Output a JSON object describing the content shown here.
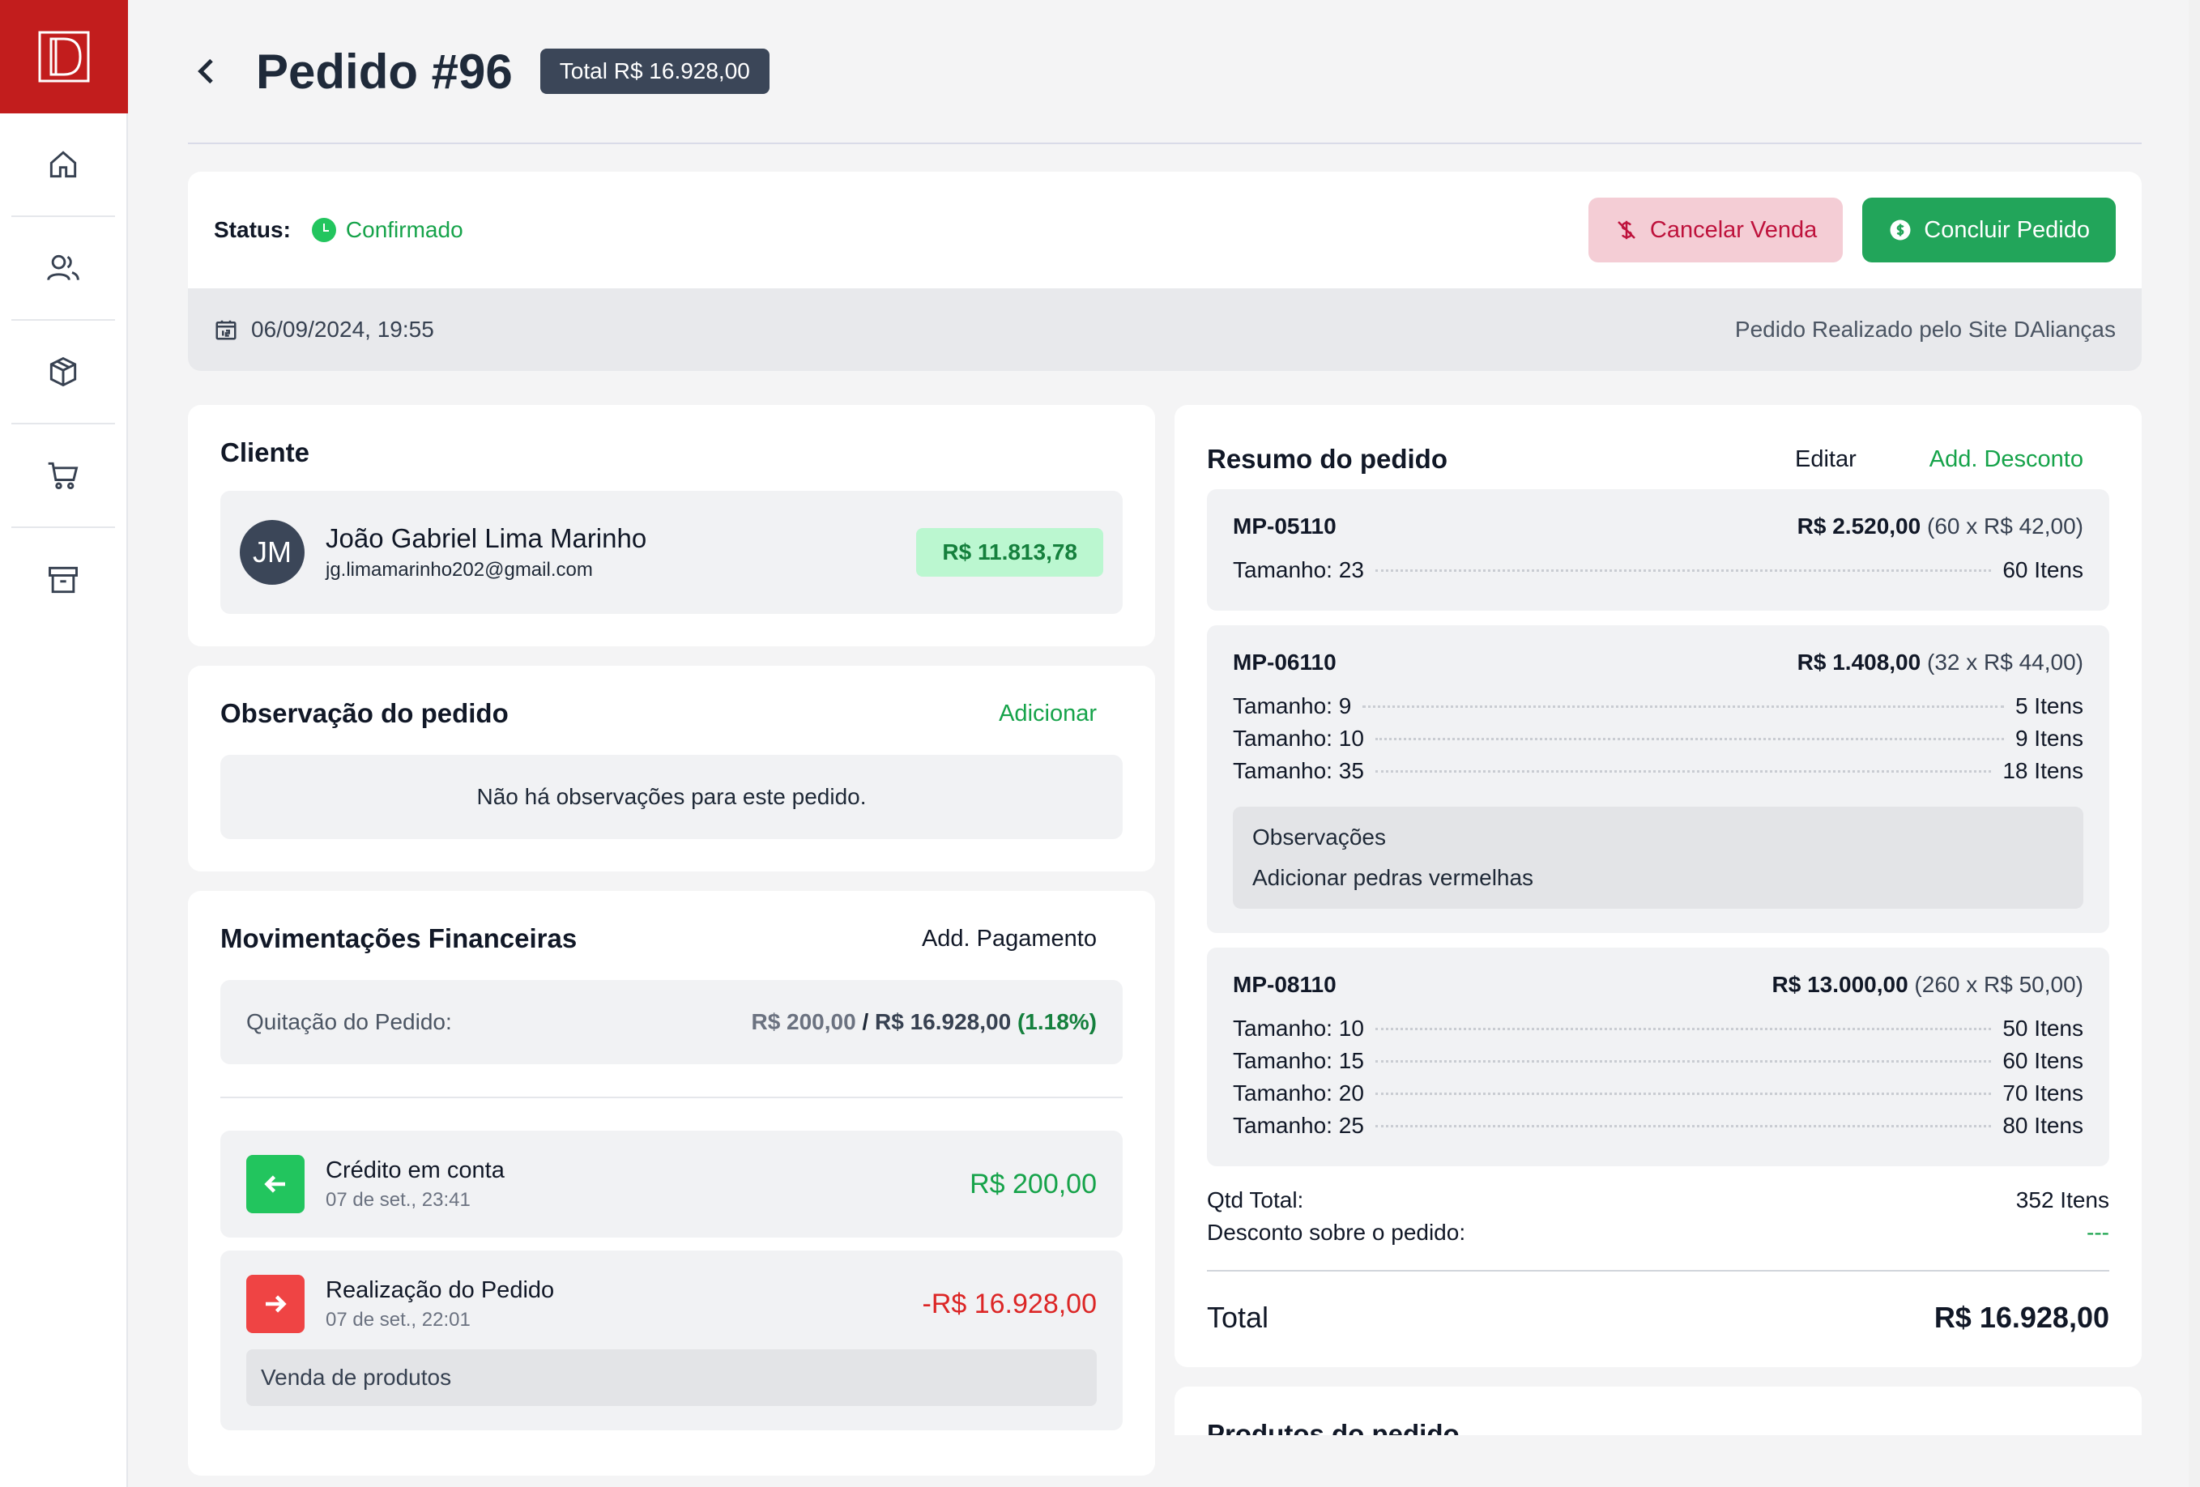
{
  "sidebar": {
    "logo_icon": "brand-logo-icon",
    "items": [
      {
        "icon": "home-icon"
      },
      {
        "icon": "users-icon"
      },
      {
        "icon": "box-icon"
      },
      {
        "icon": "cart-icon"
      },
      {
        "icon": "archive-icon"
      }
    ]
  },
  "header": {
    "title": "Pedido #96",
    "total_badge": "Total R$ 16.928,00"
  },
  "status": {
    "label": "Status:",
    "value": "Confirmado",
    "cancel_label": "Cancelar Venda",
    "conclude_label": "Concluir Pedido"
  },
  "info": {
    "date": "06/09/2024, 19:55",
    "origin": "Pedido Realizado pelo Site DAlianças"
  },
  "client": {
    "title": "Cliente",
    "initials": "JM",
    "name": "João Gabriel Lima Marinho",
    "email": "jg.limamarinho202@gmail.com",
    "amount": "R$ 11.813,78"
  },
  "observation": {
    "title": "Observação do pedido",
    "add_label": "Adicionar",
    "empty_text": "Não há observações para este pedido."
  },
  "finance": {
    "title": "Movimentações Financeiras",
    "add_label": "Add. Pagamento",
    "quitacao_label": "Quitação do Pedido:",
    "paid": "R$ 200,00",
    "separator": "/",
    "total": "R$ 16.928,00",
    "percent": "(1.18%)",
    "movements": [
      {
        "title": "Crédito em conta",
        "date": "07 de set., 23:41",
        "amount": "R$ 200,00"
      },
      {
        "title": "Realização do Pedido",
        "date": "07 de set., 22:01",
        "amount": "-R$ 16.928,00",
        "note": "Venda de produtos"
      }
    ]
  },
  "summary": {
    "title": "Resumo do pedido",
    "edit_label": "Editar",
    "discount_label": "Add. Desconto",
    "products": [
      {
        "code": "MP-05110",
        "price": "R$ 2.520,00",
        "detail": "(60 x R$ 42,00)",
        "sizes": [
          {
            "label": "Tamanho: 23",
            "qty": "60 Itens"
          }
        ]
      },
      {
        "code": "MP-06110",
        "price": "R$ 1.408,00",
        "detail": "(32 x R$ 44,00)",
        "sizes": [
          {
            "label": "Tamanho: 9",
            "qty": "5 Itens"
          },
          {
            "label": "Tamanho: 10",
            "qty": "9 Itens"
          },
          {
            "label": "Tamanho: 35",
            "qty": "18 Itens"
          }
        ],
        "obs_title": "Observações",
        "obs_text": "Adicionar pedras vermelhas"
      },
      {
        "code": "MP-08110",
        "price": "R$ 13.000,00",
        "detail": "(260 x R$ 50,00)",
        "sizes": [
          {
            "label": "Tamanho: 10",
            "qty": "50 Itens"
          },
          {
            "label": "Tamanho: 15",
            "qty": "60 Itens"
          },
          {
            "label": "Tamanho: 20",
            "qty": "70 Itens"
          },
          {
            "label": "Tamanho: 25",
            "qty": "80 Itens"
          }
        ]
      }
    ],
    "qtd_label": "Qtd Total:",
    "qtd_value": "352 Itens",
    "discount_row_label": "Desconto sobre o pedido:",
    "discount_row_value": "---",
    "total_label": "Total",
    "total_value": "R$ 16.928,00"
  },
  "next_section": {
    "title": "Produtos do pedido"
  },
  "colors": {
    "brand": "#c21d1d",
    "success": "#16a34a",
    "danger": "#dc2626",
    "badge": "#3b4658"
  }
}
